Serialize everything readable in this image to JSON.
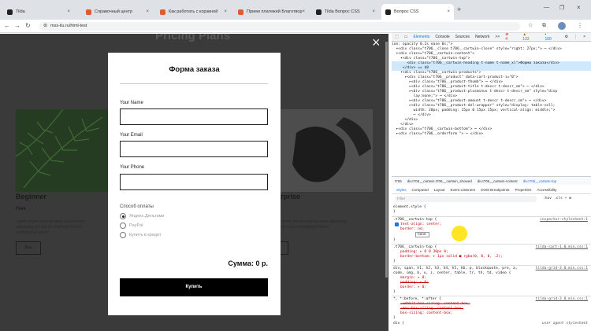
{
  "tabs": [
    {
      "label": "Tilda"
    },
    {
      "label": "Справочный центр"
    },
    {
      "label": "Как работать с корзиной"
    },
    {
      "label": "Прием платежей Благотвор"
    },
    {
      "label": "Tilda Вопрос CSS"
    },
    {
      "label": "Вопрос CSS"
    }
  ],
  "url": "mss-ilu.ru/html-test",
  "page": {
    "heading": "Pricing Plans",
    "left_card": {
      "title": "Beginner",
      "price": "Free",
      "text": "Lorem ipsum dolor sit amet consectetur\nadipiscing elit sed do eiusmod tempor\nincididunt ut labore",
      "button": "Buy"
    },
    "right_card": {
      "title": "rprise",
      "text": "Lorem ipsum dolor sit amet adipiscing\nelit tempor incididunt labore"
    }
  },
  "modal": {
    "title": "Форма заказа",
    "name_label": "Your Name",
    "email_label": "Your Email",
    "phone_label": "Your Phone",
    "payment_label": "Способ оплаты",
    "options": [
      "Яндекс.Деньгами",
      "PayPal",
      "Купить в кредит"
    ],
    "selected_option": 0,
    "total": "Сумма: 0 р.",
    "submit": "Купить",
    "close": "×"
  },
  "devtools": {
    "tabs": [
      "Elements",
      "Console",
      "Sources",
      "Network",
      ">>"
    ],
    "badges": {
      "errors": "4",
      "warnings": "133",
      "info": "100"
    },
    "dom_lines": [
      "ion: opacity 0.2s ease 0s;\">",
      "  ▾<div class=\"t706__close t706__cartwin-close\" style=\"right: 27px;\"> ⋯ </div>",
      "  ▾<div class=\"t706__cartwin-content\">",
      "    ▾<div class=\"t706__cartwin-top\">",
      "       <div class=\"t706__cartwin-heading t-name t-name_xl\">Форма заказа</div>",
      "     </div> == $0",
      "    ▾<div class=\"t706__cartwin-products\">",
      "      ▸<div class=\"t706__product\" data-cart-product-i=\"0\">",
      "        ▸<div class=\"t706__product-thumb\"> ⋯ </div>",
      "        ▸<div class=\"t706__product-title t-descr t-descr_sm\"> ⋯ </div>",
      "        ▸<div class=\"t706__product-plusminus t-descr t-descr_sm\" style=\"disp",
      "          lay:none;\"> ⋯ </div>",
      "        ▸<div class=\"t706__product-amount t-descr t-descr_sm\"> ⋯ </div>",
      "        ▸<div class=\"t706__product-del-wrapper\" style=\"display: table-cell;",
      "          width: 20px; padding: 15px 0 15px 15px; vertical-align: middle;\">",
      "          ⋯ </div>",
      "      </div>",
      "    </div>",
      "  ▸<div class=\"t706__cartwin-bottom\"> ⋯ </div>",
      "  ▸<div class=\"t706__orderform \"> ⋯ </div>"
    ],
    "breadcrumbs": [
      "t706",
      "div.t706__cartwin.t706__cartwin_showed",
      "div.t706__cartwin-content",
      "div.t706__cartwin-top"
    ],
    "style_tabs": [
      "Styles",
      "Computed",
      "Layout",
      "Event Listeners",
      "DOM Breakpoints",
      "Properties",
      "Accessibility"
    ],
    "filter_placeholder": "Filter",
    "filter_tools": ":hov .cls + ⊞",
    "rules": [
      {
        "selector": "element.style {",
        "lines": [
          "}"
        ],
        "source": ""
      },
      {
        "selector": ".t706__cartwin-top {",
        "lines": [
          "text-align: center;",
          "border: no;",
          "}"
        ],
        "source": "inspector-stylesheet:1"
      },
      {
        "selector": ".t706__cartwin-top {",
        "lines": [
          "padding: ▸ 0 0 30px 0;",
          "border-bottom: ▸ 1px solid ■ rgba(0, 0, 0, .2);",
          "}"
        ],
        "source": "tilda-cart-1.0.min.css:1"
      },
      {
        "selector": "div, span, h1, h2, h3, h4, h5, h6, p, blockquote, pre, a,",
        "lines": [
          "code, img, b, u, i, center, table, tr, th, td, video {",
          "margin: ▸ 0;",
          "padding: ▸ 0;",
          "border: ▸ 0;",
          "}"
        ],
        "source": "tilda-grid-3.0.min.css:1"
      },
      {
        "selector": "*, *:before, *:after {",
        "lines": [
          "-webkit-box-sizing: content-box;",
          "-moz-box-sizing: content-box;",
          "box-sizing: content-box;",
          "}"
        ],
        "source": "tilda-grid-3.0.min.css:1"
      },
      {
        "selector": "div {",
        "lines": [],
        "source": "user agent stylesheet"
      }
    ],
    "autocomplete": [
      "none"
    ]
  }
}
